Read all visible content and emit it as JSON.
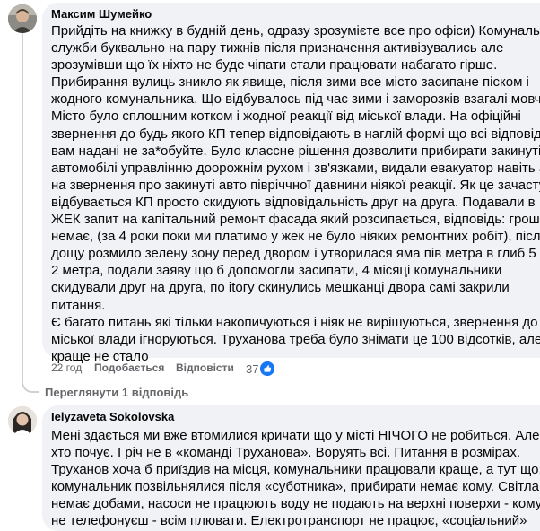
{
  "comments": [
    {
      "author": "Максим Шумейко",
      "text": "Прийдіть на книжку в будній день, одразу зрозумієте все про офіси) Комунальні\nслужби буквально на пару тижнів після призначення активізувались але\nзрозумівши що їх ніхто не буде чіпати стали працювати набагато гірше.\nПрибирання вулиць зникло як явище, після зими все місто засипане піском і\nжодного комунальника. Що відбувалось під час зими і заморозків взагалі мовчу.\nМісто було сплошним котком і жодної реакції від міської влади. На офіційні\nзвернення до будь якого КП тепер відповідають в наглій формі що всі відповіді\nвам надані не за*обуйте. Було классне рішення дозволити прибирати закинуті\nавтомобілі управлінню доорожнім рухом і зв'язками, видали евакуатор навіть а\nна звернення про закинуті авто півріччної давнини ніякої реакції. Як це зачасту\nвідбувається КП просто скидують відповідальність друг на друга. Подавали в\nЖЕК запит на капітальний ремонт фасада який розсипається, відповідь: грошей\nнемає, (за 4 роки поки ми платимо у жек не було ніяких ремонтних робіт), після\nдощу розмило зелену зону перед двором і утворилася яма пів метра в глиб 5 на\n2 метра, подали заяву що б допомогли засипати, 4 місяці комунальники\nскидували друг на друга, по itoгу скинулись мешканці двора самі закрили\nпитання.\nЄ багато питань які тільки накопичуються і ніяк не вирішуються, звернення до\nміської влади ігноруються. Труханова треба було знімати це 100 відсотків, але\nкраще не стало",
      "time": "22 год",
      "like_label": "Подобається",
      "reply_label": "Відповісти",
      "reaction_count": "37"
    },
    {
      "author": "Ielyzaveta Sokolovska",
      "text": "Мені здається ми вже втомилися кричати що у місті НІЧОГО не робиться. Але\nхто почує. І річ не в «команді Труханова». Воруять всі. Питання в розмірах.\nТруханов хоча б приїздив на місця, комунальники працювали краще, а тут що:\nкомунальник позвільнялися після «суботника», прибирати немає кому. Світла\nнемає добами, насоси не працюють воду не подають на верхні поверхи - кому\nне телефонуєш - всім плювати. Електротранспорт не працює, «соціальний»"
    }
  ],
  "view_replies_label": "Переглянути 1 відповідь",
  "colors": {
    "bubble_bg": "#f0f2f5",
    "meta_text": "#65676b",
    "like_blue": "#1877f2",
    "thread_line": "#ced0d4"
  },
  "icons": [
    "like-icon"
  ]
}
